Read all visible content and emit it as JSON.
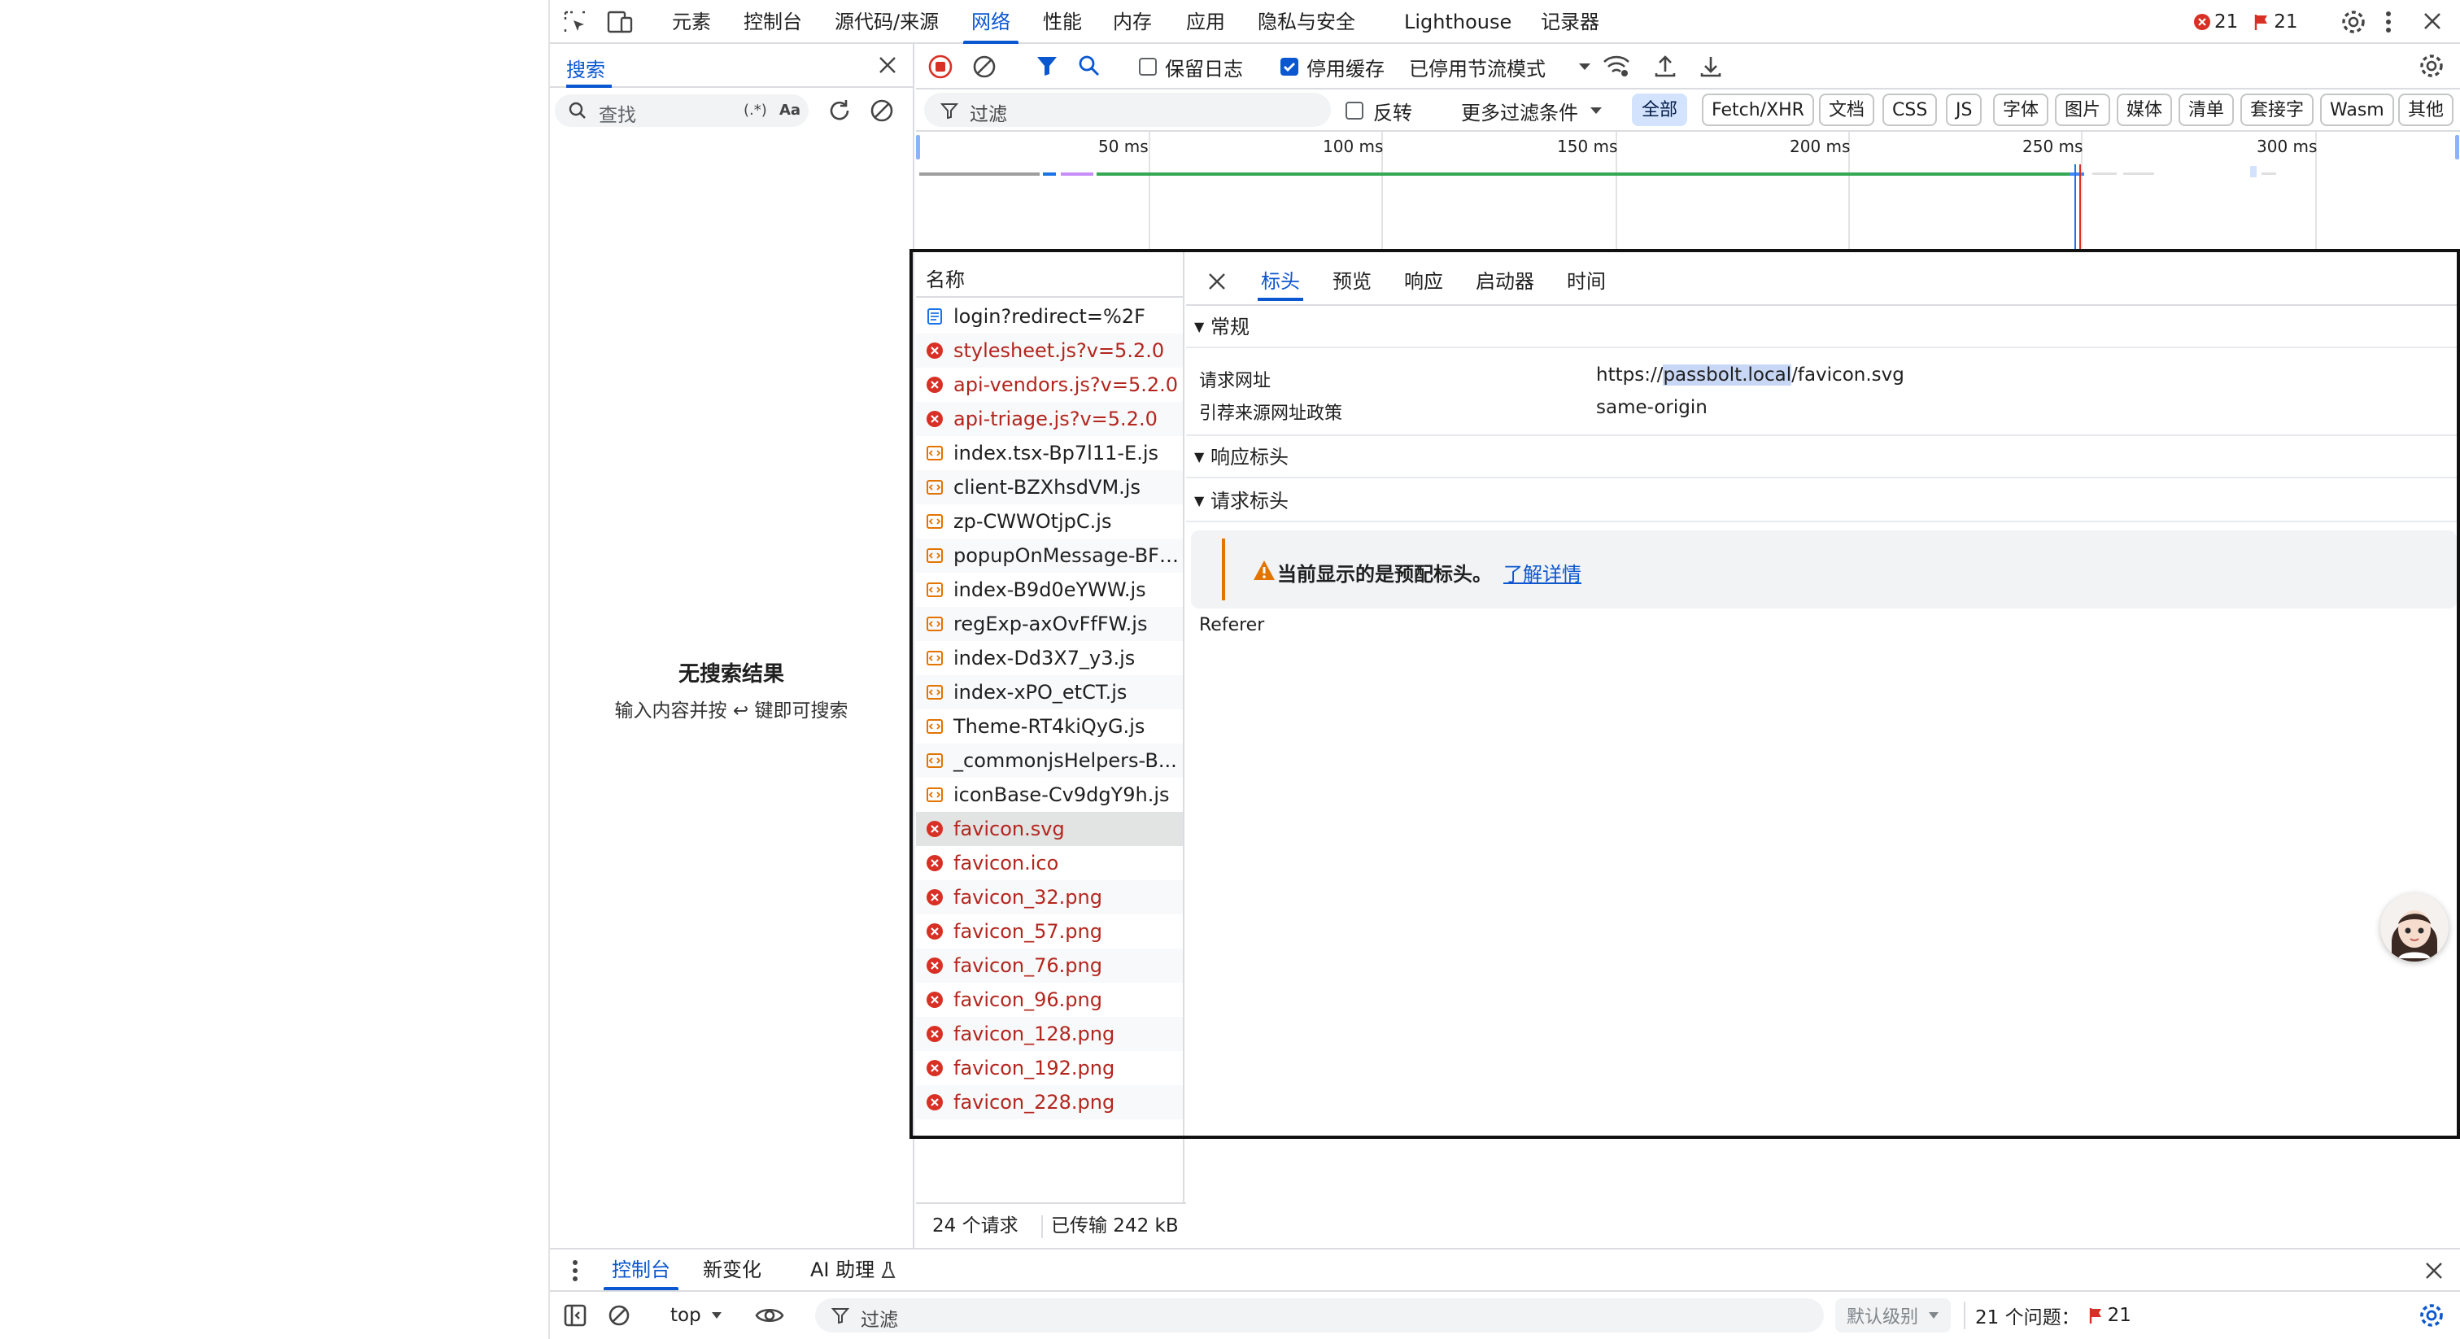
{
  "main_tabs": [
    "元素",
    "控制台",
    "源代码/来源",
    "网络",
    "性能",
    "内存",
    "应用",
    "隐私与安全",
    "Lighthouse",
    "记录器"
  ],
  "issues": {
    "errors": "21",
    "warnings": "21"
  },
  "search_panel": {
    "title": "搜索",
    "placeholder": "查找",
    "regex_label": "(.*)",
    "case_label": "Aa",
    "empty_title": "无搜索结果",
    "empty_hint": "输入内容并按 ↩ 键即可搜索"
  },
  "network_toolbar": {
    "preserve_log": "保留日志",
    "disable_cache": "停用缓存",
    "throttle": "已停用节流模式"
  },
  "filter_bar": {
    "placeholder": "过滤",
    "invert": "反转",
    "more_filters": "更多过滤条件",
    "chips": [
      "全部",
      "Fetch/XHR",
      "文档",
      "CSS",
      "JS",
      "字体",
      "图片",
      "媒体",
      "清单",
      "套接字",
      "Wasm",
      "其他"
    ]
  },
  "timeline": {
    "ticks": [
      "50 ms",
      "100 ms",
      "150 ms",
      "200 ms",
      "250 ms",
      "300 ms"
    ]
  },
  "request_list": {
    "header": "名称",
    "rows": [
      {
        "name": "login?redirect=%2F",
        "kind": "doc",
        "status": "ok"
      },
      {
        "name": "stylesheet.js?v=5.2.0",
        "kind": "err",
        "status": "error"
      },
      {
        "name": "api-vendors.js?v=5.2.0",
        "kind": "err",
        "status": "error"
      },
      {
        "name": "api-triage.js?v=5.2.0",
        "kind": "err",
        "status": "error"
      },
      {
        "name": "index.tsx-Bp7l11-E.js",
        "kind": "script",
        "status": "ok"
      },
      {
        "name": "client-BZXhsdVM.js",
        "kind": "script",
        "status": "ok"
      },
      {
        "name": "zp-CWWOtjpC.js",
        "kind": "script",
        "status": "ok"
      },
      {
        "name": "popupOnMessage-BFt...",
        "kind": "script",
        "status": "ok"
      },
      {
        "name": "index-B9d0eYWW.js",
        "kind": "script",
        "status": "ok"
      },
      {
        "name": "regExp-axOvFfFW.js",
        "kind": "script",
        "status": "ok"
      },
      {
        "name": "index-Dd3X7_y3.js",
        "kind": "script",
        "status": "ok"
      },
      {
        "name": "index-xPO_etCT.js",
        "kind": "script",
        "status": "ok"
      },
      {
        "name": "Theme-RT4kiQyG.js",
        "kind": "script",
        "status": "ok"
      },
      {
        "name": "_commonjsHelpers-B...",
        "kind": "script",
        "status": "ok"
      },
      {
        "name": "iconBase-Cv9dgY9h.js",
        "kind": "script",
        "status": "ok"
      },
      {
        "name": "favicon.svg",
        "kind": "err",
        "status": "error",
        "selected": true
      },
      {
        "name": "favicon.ico",
        "kind": "err",
        "status": "error"
      },
      {
        "name": "favicon_32.png",
        "kind": "err",
        "status": "error"
      },
      {
        "name": "favicon_57.png",
        "kind": "err",
        "status": "error"
      },
      {
        "name": "favicon_76.png",
        "kind": "err",
        "status": "error"
      },
      {
        "name": "favicon_96.png",
        "kind": "err",
        "status": "error"
      },
      {
        "name": "favicon_128.png",
        "kind": "err",
        "status": "error"
      },
      {
        "name": "favicon_192.png",
        "kind": "err",
        "status": "error"
      },
      {
        "name": "favicon_228.png",
        "kind": "err",
        "status": "error"
      }
    ]
  },
  "status": {
    "requests": "24 个请求",
    "transferred": "已传输 242 kB"
  },
  "details": {
    "tabs": [
      "标头",
      "预览",
      "响应",
      "启动器",
      "时间"
    ],
    "general_title": "常规",
    "request_url_label": "请求网址",
    "request_url_prefix": "https://",
    "request_url_host": "passbolt.local",
    "request_url_path": "/favicon.svg",
    "referrer_policy_label": "引荐来源网址政策",
    "referrer_policy_value": "same-origin",
    "response_headers_title": "响应标头",
    "request_headers_title": "请求标头",
    "warning_text": "当前显示的是预配标头。",
    "warning_link": "了解详情",
    "referer_label": "Referer"
  },
  "drawer": {
    "tabs": [
      "控制台",
      "新变化",
      "AI 助理"
    ],
    "context": "top",
    "filter_placeholder": "过滤",
    "level": "默认级别",
    "issues_label": "21 个问题：",
    "issues_count": "21"
  },
  "colors": {
    "accent": "#0b57d0",
    "error": "#b3261e",
    "warning": "#e37400"
  }
}
